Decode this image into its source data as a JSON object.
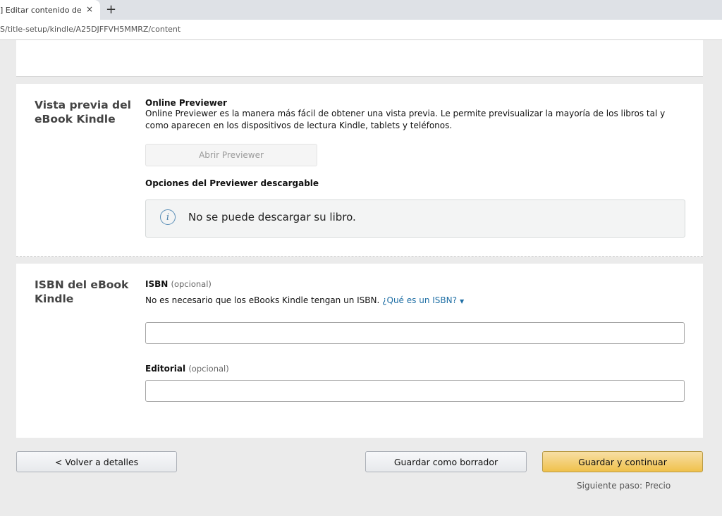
{
  "browser": {
    "tab_title": "] Editar contenido del eBook",
    "tab_close": "×",
    "new_tab": "+",
    "url": "S/title-setup/kindle/A25DJFFVH5MMRZ/content"
  },
  "preview": {
    "section_title": "Vista previa del eBook Kindle",
    "online_title": "Online Previewer",
    "online_desc": "Online Previewer es la manera más fácil de obtener una vista previa. Le permite previsualizar la mayoría de los libros tal y como aparecen en los dispositivos de lectura Kindle, tablets y teléfonos.",
    "open_button": "Abrir Previewer",
    "download_title": "Opciones del Previewer descargable",
    "alert_icon": "info-icon",
    "alert_text": "No se puede descargar su libro."
  },
  "isbn": {
    "section_title": "ISBN del eBook Kindle",
    "isbn_label": "ISBN",
    "optional": "(opcional)",
    "isbn_desc": "No es necesario que los eBooks Kindle tengan un ISBN.",
    "isbn_link": "¿Qué es un ISBN?",
    "isbn_value": "",
    "publisher_label": "Editorial",
    "publisher_value": ""
  },
  "footer": {
    "back_button": "< Volver a detalles",
    "draft_button": "Guardar como borrador",
    "continue_button": "Guardar y continuar",
    "next_step": "Siguiente paso: Precio"
  },
  "colors": {
    "primary_button": "#f0c14b",
    "link": "#1f6fa5",
    "background": "#ebebeb"
  }
}
